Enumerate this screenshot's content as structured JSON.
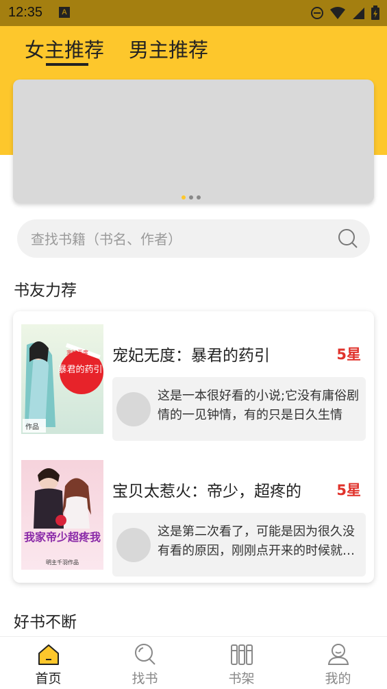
{
  "status_bar": {
    "time": "12:35"
  },
  "tabs": [
    {
      "label": "女主推荐",
      "active": true
    },
    {
      "label": "男主推荐",
      "active": false
    }
  ],
  "banner": {
    "page_count": 3,
    "active_index": 0
  },
  "search": {
    "placeholder": "查找书籍（书名、作者）"
  },
  "sections": {
    "recommend_title": "书友力荐",
    "more_title": "好书不断"
  },
  "books": [
    {
      "title": "宠妃无度：暴君的药引",
      "rating": "5星",
      "cover_title": "暴君的药引",
      "cover_subtitle": "宠妃无度",
      "cover_author": "作品",
      "review": "这是一本很好看的小说;它没有庸俗剧情的一见钟情，有的只是日久生情"
    },
    {
      "title": "宝贝太惹火：帝少，超疼的",
      "rating": "5星",
      "cover_title": "我家帝少超疼我",
      "cover_subtitle": "",
      "cover_author": "明主千羽作品",
      "review": "这是第二次看了，可能是因为很久没有看的原因，刚刚点开来的时候就停不下来了"
    }
  ],
  "bottom_nav": [
    {
      "label": "首页",
      "icon": "home-icon",
      "active": true
    },
    {
      "label": "找书",
      "icon": "search-icon",
      "active": false
    },
    {
      "label": "书架",
      "icon": "bookshelf-icon",
      "active": false
    },
    {
      "label": "我的",
      "icon": "profile-icon",
      "active": false
    }
  ],
  "colors": {
    "accent": "#fdc72c",
    "rating": "#e0322b",
    "status_bar": "#a47f10"
  }
}
